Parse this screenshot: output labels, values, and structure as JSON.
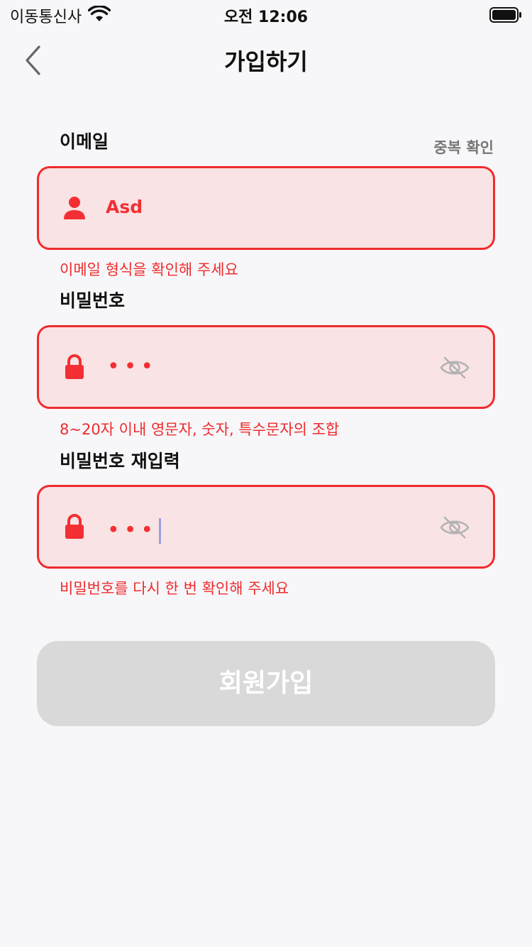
{
  "status_bar": {
    "carrier": "이동통신사",
    "time": "오전 12:06"
  },
  "nav": {
    "title": "가입하기"
  },
  "email": {
    "label": "이메일",
    "dup_check": "중복 확인",
    "value": "Asd",
    "error": "이메일 형식을 확인해 주세요"
  },
  "password": {
    "label": "비밀번호",
    "masked": "•••",
    "error": "8~20자 이내 영문자, 숫자, 특수문자의 조합"
  },
  "password_confirm": {
    "label": "비밀번호 재입력",
    "masked": "•••",
    "error": "비밀번호를 다시 한 번 확인해 주세요"
  },
  "submit": {
    "label": "회원가입"
  },
  "colors": {
    "error": "#ef2b2d",
    "input_bg": "#f9e3e4",
    "button_disabled": "#d9d9d9",
    "background": "#f7f7f9"
  },
  "icons": {
    "back": "chevron-left-icon",
    "email_field": "user-icon",
    "password_field": "lock-icon",
    "visibility": "eye-slash-icon"
  }
}
